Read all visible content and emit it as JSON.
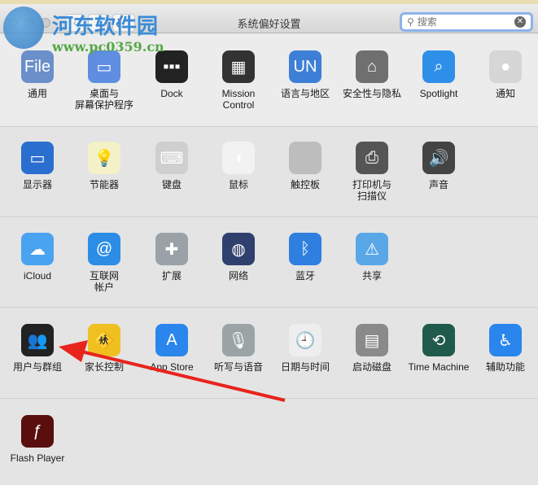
{
  "window": {
    "title": "系统偏好设置",
    "back": "‹",
    "forward": "›",
    "grid": "⋮⋮⋮"
  },
  "search": {
    "placeholder": "搜索",
    "value": ""
  },
  "watermark": {
    "name": "河东软件园",
    "url": "www.pc0359.cn"
  },
  "sections": [
    [
      {
        "label": "通用",
        "icon": "general-icon",
        "color": "#6a8fc9",
        "glyph": "File"
      },
      {
        "label": "桌面与\n屏幕保护程序",
        "icon": "desktop-icon",
        "color": "#5f8ee0",
        "glyph": "▭"
      },
      {
        "label": "Dock",
        "icon": "dock-icon",
        "color": "#222",
        "glyph": "▪▪▪"
      },
      {
        "label": "Mission\nControl",
        "icon": "mission-control-icon",
        "color": "#333",
        "glyph": "▦"
      },
      {
        "label": "语言与地区",
        "icon": "language-icon",
        "color": "#3d7fd6",
        "glyph": "UN"
      },
      {
        "label": "安全性与隐私",
        "icon": "security-icon",
        "color": "#6f6f6f",
        "glyph": "⌂"
      },
      {
        "label": "Spotlight",
        "icon": "spotlight-icon",
        "color": "#2e8fe8",
        "glyph": "⌕"
      },
      {
        "label": "通知",
        "icon": "notifications-icon",
        "color": "#d6d6d6",
        "glyph": "●"
      }
    ],
    [
      {
        "label": "显示器",
        "icon": "display-icon",
        "color": "#2a6fcf",
        "glyph": "▭"
      },
      {
        "label": "节能器",
        "icon": "energy-saver-icon",
        "color": "#f4f0c8",
        "glyph": "💡"
      },
      {
        "label": "键盘",
        "icon": "keyboard-icon",
        "color": "#cfcfcf",
        "glyph": "⌨"
      },
      {
        "label": "鼠标",
        "icon": "mouse-icon",
        "color": "#f2f2f2",
        "glyph": "◖"
      },
      {
        "label": "触控板",
        "icon": "trackpad-icon",
        "color": "#bdbdbd",
        "glyph": ""
      },
      {
        "label": "打印机与\n扫描仪",
        "icon": "printer-icon",
        "color": "#555",
        "glyph": "⎙"
      },
      {
        "label": "声音",
        "icon": "sound-icon",
        "color": "#444",
        "glyph": "🔊"
      }
    ],
    [
      {
        "label": "iCloud",
        "icon": "icloud-icon",
        "color": "#4aa3f0",
        "glyph": "☁"
      },
      {
        "label": "互联网\n帐户",
        "icon": "internet-accounts-icon",
        "color": "#2c8de6",
        "glyph": "@"
      },
      {
        "label": "扩展",
        "icon": "extensions-icon",
        "color": "#9aa2a8",
        "glyph": "✚"
      },
      {
        "label": "网络",
        "icon": "network-icon",
        "color": "#2f3f6e",
        "glyph": "◍"
      },
      {
        "label": "蓝牙",
        "icon": "bluetooth-icon",
        "color": "#2f7fe0",
        "glyph": "ᛒ"
      },
      {
        "label": "共享",
        "icon": "sharing-icon",
        "color": "#5aa7e8",
        "glyph": "⚠"
      }
    ],
    [
      {
        "label": "用户与群组",
        "icon": "users-groups-icon",
        "color": "#222",
        "glyph": "👥"
      },
      {
        "label": "家长控制",
        "icon": "parental-controls-icon",
        "color": "#f0c020",
        "glyph": "🚸"
      },
      {
        "label": "App Store",
        "icon": "app-store-icon",
        "color": "#2a86ec",
        "glyph": "A"
      },
      {
        "label": "听写与语音",
        "icon": "dictation-icon",
        "color": "#9aa4a4",
        "glyph": "🎙"
      },
      {
        "label": "日期与时间",
        "icon": "date-time-icon",
        "color": "#eeeeee",
        "glyph": "🕘"
      },
      {
        "label": "启动磁盘",
        "icon": "startup-disk-icon",
        "color": "#8a8a8a",
        "glyph": "▤"
      },
      {
        "label": "Time Machine",
        "icon": "time-machine-icon",
        "color": "#1f5a4a",
        "glyph": "⟲"
      },
      {
        "label": "辅助功能",
        "icon": "accessibility-icon",
        "color": "#2a86ec",
        "glyph": "♿"
      }
    ],
    [
      {
        "label": "Flash Player",
        "icon": "flash-player-icon",
        "color": "#5a0e0e",
        "glyph": "ƒ"
      }
    ]
  ],
  "annotation_color": "#e8241c"
}
